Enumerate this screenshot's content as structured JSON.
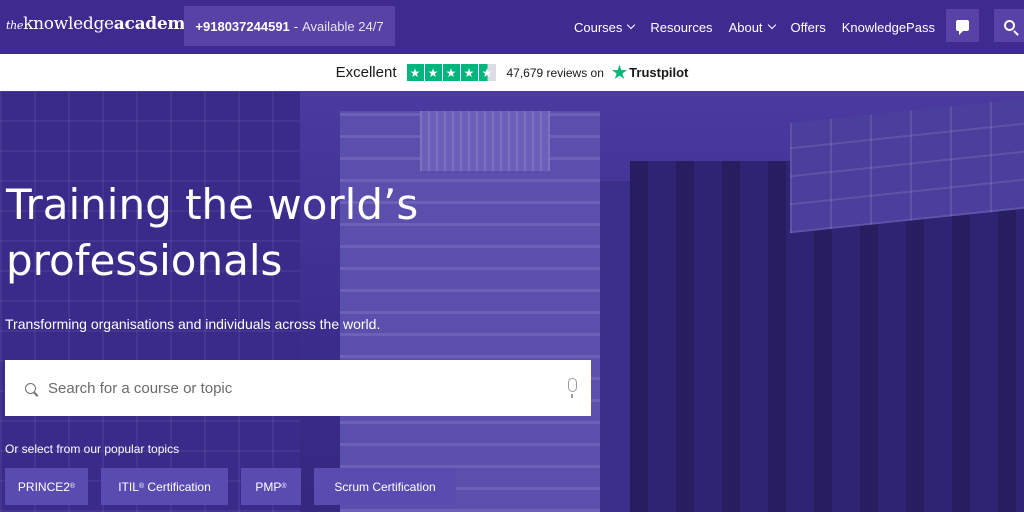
{
  "nav": {
    "logo_the": "the",
    "logo_knowledge": "knowledge",
    "logo_academy": "academy",
    "phone_number": "+918037244591",
    "phone_separator": "-",
    "availability": "Available 24/7",
    "menu": [
      {
        "label": "Courses",
        "has_dropdown": true
      },
      {
        "label": "Resources",
        "has_dropdown": false
      },
      {
        "label": "About",
        "has_dropdown": true
      },
      {
        "label": "Offers",
        "has_dropdown": false
      },
      {
        "label": "KnowledgePass",
        "has_dropdown": false
      }
    ],
    "icons": [
      "chat-icon",
      "search-icon"
    ]
  },
  "trustbar": {
    "rating_text": "Excellent",
    "stars": 4.5,
    "reviews_text": "47,679 reviews on",
    "brand": "Trustpilot",
    "star_color": "#00b67a"
  },
  "hero": {
    "title": "Training the world’s professionals",
    "subtitle": "Transforming organisations and individuals across the world.",
    "search_placeholder": "Search for a course or topic",
    "popular_label": "Or select from our popular topics",
    "topics": [
      {
        "label": "PRINCE2",
        "mark": "®"
      },
      {
        "label": "ITIL",
        "mark": "®",
        "suffix": " Certification"
      },
      {
        "label": "PMP",
        "mark": "®"
      },
      {
        "label": "Scrum Certification",
        "mark": ""
      }
    ]
  },
  "colors": {
    "nav_bg": "#3f2a8f",
    "accent_box": "#5842a6",
    "chip_bg": "#5a4bb0"
  }
}
